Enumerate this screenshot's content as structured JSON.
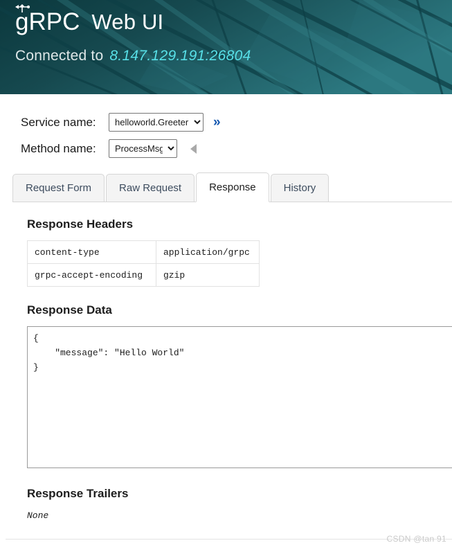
{
  "header": {
    "brand": "gRPC",
    "brand_icon": "grpc-network-node-icon",
    "title": "Web UI",
    "connected_label": "Connected to",
    "connected_address": "8.147.129.191:26804",
    "bg_color": "#1d595f",
    "address_color": "#58e0e8"
  },
  "form": {
    "service": {
      "label": "Service name:",
      "value": "helloworld.Greeter",
      "options": [
        "helloworld.Greeter"
      ],
      "expand_glyph": "»"
    },
    "method": {
      "label": "Method name:",
      "value": "ProcessMsg",
      "options": [
        "ProcessMsg"
      ],
      "collapse_glyph": "◀"
    }
  },
  "tabs": [
    {
      "label": "Request Form",
      "active": false
    },
    {
      "label": "Raw Request",
      "active": false
    },
    {
      "label": "Response",
      "active": true
    },
    {
      "label": "History",
      "active": false
    }
  ],
  "response": {
    "headers_title": "Response Headers",
    "headers": [
      {
        "key": "content-type",
        "value": "application/grpc"
      },
      {
        "key": "grpc-accept-encoding",
        "value": "gzip"
      }
    ],
    "data_title": "Response Data",
    "data_body": "{\n    \"message\": \"Hello World\"\n}",
    "trailers_title": "Response Trailers",
    "trailers_value": "None"
  },
  "watermark": {
    "text": "CSDN @tan 91"
  }
}
